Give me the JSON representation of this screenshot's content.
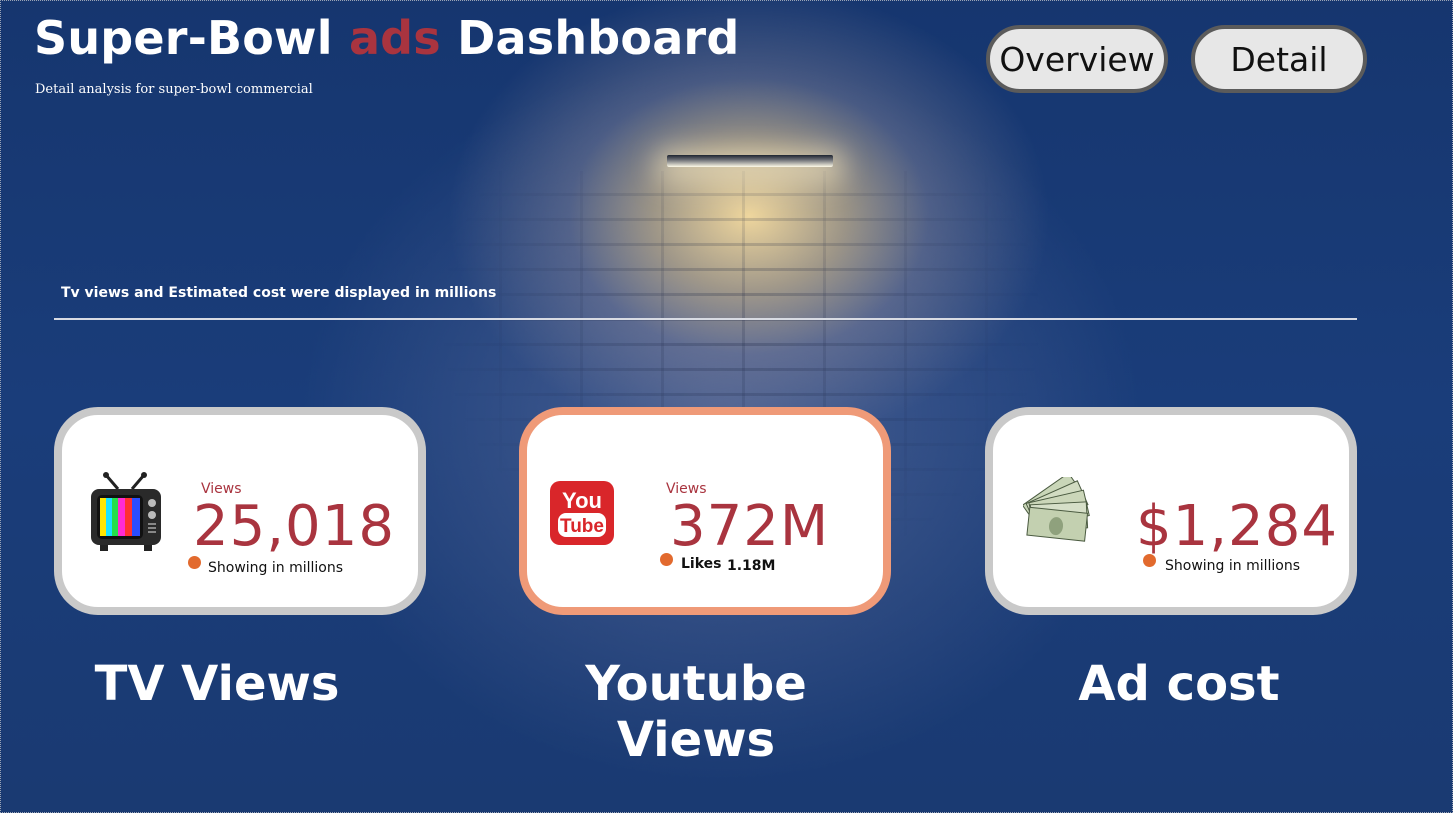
{
  "header": {
    "title_part1": "Super-Bowl",
    "title_accent": "ads",
    "title_part2": "Dashboard",
    "subtitle": "Detail analysis for super-bowl commercial"
  },
  "nav": {
    "overview_label": "Overview",
    "detail_label": "Detail"
  },
  "note": "Tv views and Estimated cost were displayed in millions",
  "cards": {
    "tv": {
      "label": "Views",
      "value": "25,018",
      "foot": "Showing in millions",
      "caption": "TV Views",
      "icon": "retro-tv-icon"
    },
    "youtube": {
      "label": "Views",
      "value": "372M",
      "likes_label": "Likes",
      "likes_value": "1.18M",
      "caption": "Youtube Views",
      "icon": "youtube-icon",
      "icon_text_top": "You",
      "icon_text_bottom": "Tube"
    },
    "adcost": {
      "value": "$1,284",
      "foot": "Showing in millions",
      "caption": "Ad cost",
      "icon": "money-stack-icon"
    }
  },
  "colors": {
    "background": "#1a3a72",
    "accent": "#a9343f",
    "dot": "#e26a2e",
    "youtube_border": "#ef9a78",
    "card_border": "#c9c9c9"
  }
}
